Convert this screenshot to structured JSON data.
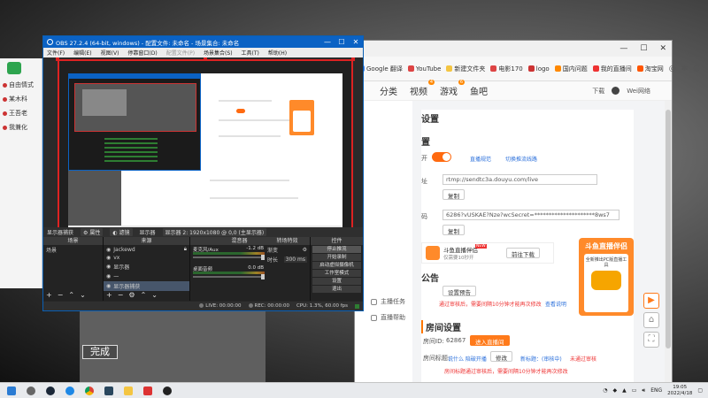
{
  "background": {
    "caption": "完成"
  },
  "left_app": {
    "items": [
      "自由情式",
      "某木科",
      "王吾老",
      "我兼化"
    ]
  },
  "browser": {
    "window_controls": [
      "—",
      "☐",
      "✕"
    ],
    "bookmarks": [
      "Google 翻译",
      "YouTube",
      "新建文件夹",
      "电影170",
      "logo",
      "国内问题",
      "我的直播间",
      "淘宝网"
    ],
    "nav": [
      {
        "label": "分类",
        "badge": ""
      },
      {
        "label": "视频",
        "badge": "4"
      },
      {
        "label": "游戏",
        "badge": "6"
      },
      {
        "label": "鱼吧",
        "badge": ""
      }
    ],
    "download_label": "下载",
    "user_label": "Wei网络",
    "sidebar": {
      "section_title": "设置",
      "items": [
        "主播任务",
        "直播帮助"
      ]
    },
    "main": {
      "section1_title": "置",
      "live_toggle_label": "开",
      "link_rules": "直播规范",
      "link_switch": "切换推流线路",
      "rtmp_label": "址",
      "rtmp_value": "rtmp://sendtc3a.douyu.com/live",
      "copy_label": "复制",
      "key_label": "码",
      "key_value": "6286?vUSKAE?Nze?wcSecret=*********************8ws7",
      "promo_tool_name": "斗鱼直播伴侣",
      "promo_tool_badge": "NEW",
      "promo_tool_sub": "仅需要10秒开",
      "promo_tool_btn": "前往下载",
      "section2_title": "公告",
      "announce_btn": "设置预告",
      "announce_red": "通过审核后，需要间隔10分钟才能再次修改",
      "announce_link": "查看说明",
      "room_title": "房间设置",
      "room_id_label": "房间ID:",
      "room_id_value": "62867",
      "room_btn": "进入直播间",
      "room_name_label": "房间标题:",
      "room_name_value": "说什么 陪破开播",
      "room_name_edit": "修改",
      "room_name_new": "新标题：(审核中)",
      "room_name_status": "未通过审核",
      "room_red": "房间标题通过审核后，需要间隔10分钟才能再次修改"
    },
    "promo": {
      "title": "斗鱼直播伴侣",
      "sub": "全新推出PC版直播工具"
    },
    "float_icons": [
      "play-icon",
      "home-icon",
      "expand-icon"
    ]
  },
  "obs": {
    "title": "OBS 27.2.4 (64-bit, windows) - 配置文件: 未命名 - 场景集合: 未命名",
    "menu": [
      "文件(F)",
      "编辑(E)",
      "视图(V)",
      "停靠窗口(D)",
      "配置文件(P)",
      "场景集合(S)",
      "工具(T)",
      "帮助(H)"
    ],
    "dock_toolbar": [
      "显示器捕获",
      "属性",
      "滤镜",
      "显示器"
    ],
    "dock_toolbar_value": "显示器 2: 1920x1080 @ 0,0 (主显示器)",
    "docks": {
      "scenes": {
        "title": "场景",
        "items": [
          "场景"
        ]
      },
      "sources": {
        "title": "来源",
        "items": [
          "Jackewd",
          "vx",
          "显示器",
          "一",
          "显示器捕获"
        ]
      },
      "mixer": {
        "title": "混音器",
        "channels": [
          {
            "name": "麦克风/Aux",
            "db": "-1.2 dB"
          },
          {
            "name": "桌面音频",
            "db": "0.0 dB"
          }
        ]
      },
      "transitions": {
        "title": "转场特效",
        "type": "渐变",
        "duration_label": "时长",
        "duration": "300 ms"
      },
      "controls": {
        "title": "控件",
        "buttons": [
          "停止推流",
          "开始录制",
          "启动虚拟摄像机",
          "工作室模式",
          "设置",
          "退出"
        ]
      }
    },
    "status": {
      "live": "LIVE: 00:00:00",
      "rec": "REC: 00:00:00",
      "cpu": "CPU: 1.3%, 60.00 fps"
    }
  },
  "taskbar": {
    "apps": [
      "start-icon",
      "search-icon",
      "steam-icon",
      "edge-icon",
      "chrome-icon",
      "steam-icon-2",
      "files-icon",
      "app-icon",
      "obs-icon"
    ],
    "tray_lang": "ENG",
    "time": "19:05",
    "date": "2022/4/18"
  }
}
